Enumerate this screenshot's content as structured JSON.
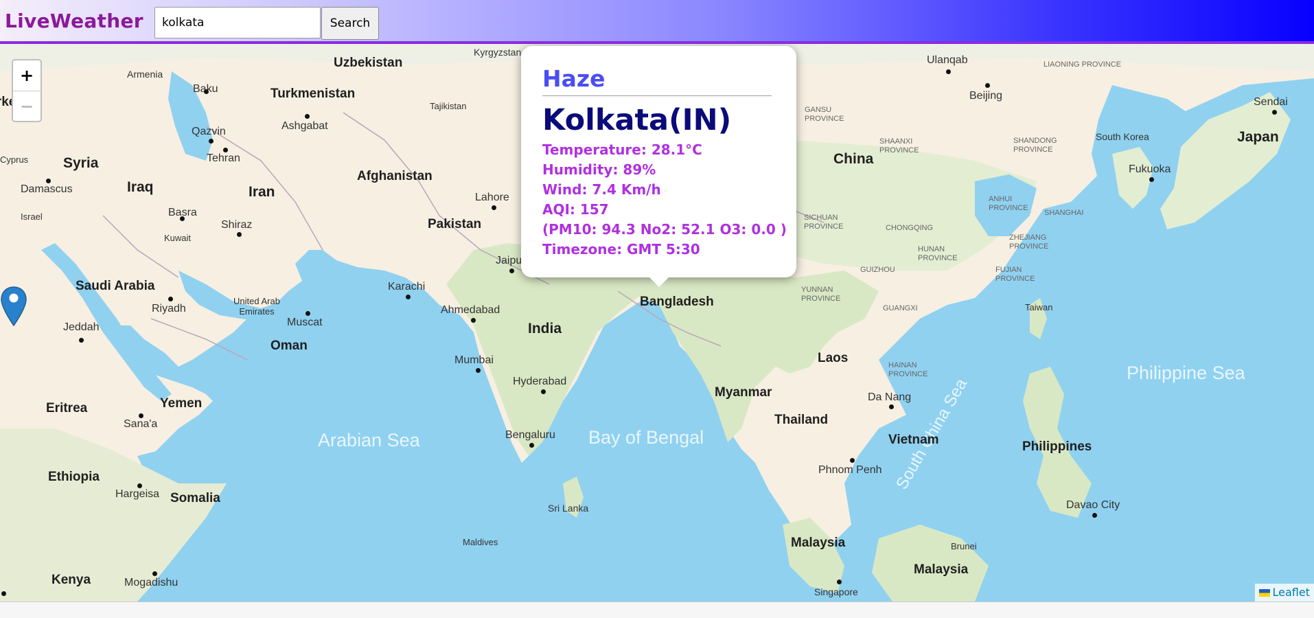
{
  "header": {
    "brand": "LiveWeather",
    "search_value": "kolkata",
    "search_button": "Search"
  },
  "map": {
    "zoom_in": "+",
    "zoom_out": "−",
    "attribution": "Leaflet",
    "countries": [
      "Uzbekistan",
      "Kyrgyzstan",
      "Turkmenistan",
      "Tajikistan",
      "Afghanistan",
      "Pakistan",
      "India",
      "Bangladesh",
      "China",
      "Iran",
      "Iraq",
      "Syria",
      "Saudi Arabia",
      "Oman",
      "Yemen",
      "Eritrea",
      "Ethiopia",
      "Somalia",
      "Kenya",
      "United Arab Emirates",
      "Kuwait",
      "Israel",
      "Cyprus",
      "Myanmar",
      "Thailand",
      "Laos",
      "Vietnam",
      "Malaysia",
      "Philippines",
      "Japan",
      "South Korea",
      "Sri Lanka",
      "Maldives",
      "Taiwan",
      "Brunei",
      "Singapore",
      "Turkey"
    ],
    "seas": [
      "Arabian Sea",
      "Bay of Bengal",
      "Philippine Sea",
      "South China Sea"
    ],
    "cities": [
      "Armenia",
      "Baku",
      "Qazvin",
      "Tehran",
      "Ashgabat",
      "Damascus",
      "Basra",
      "Shiraz",
      "Riyadh",
      "Jeddah",
      "Muscat",
      "Sana'a",
      "Hargeisa",
      "Mogadishu",
      "Karachi",
      "Lahore",
      "Jaipur",
      "Ahmedabad",
      "Mumbai",
      "Hyderabad",
      "Bengaluru",
      "Beijing",
      "Ulanqab",
      "Sendai",
      "Fukuoka",
      "Da Nang",
      "Phnom Penh",
      "Davao City",
      "Kolkata"
    ],
    "provinces": [
      "Liaoning Province",
      "Gansu Province",
      "Shaanxi Province",
      "Shandong Province",
      "Anhui Province",
      "Shanghai",
      "Sichuan Province",
      "Chongqing",
      "Hunan Province",
      "Zhejiang Province",
      "Fujian Province",
      "Guizhou",
      "Yunnan Province",
      "Guangxi",
      "Hainan Province"
    ]
  },
  "popup": {
    "condition": "Haze",
    "city": "Kolkata(IN)",
    "temperature": "Temperature: 28.1°C",
    "humidity": "Humidity: 89%",
    "wind": "Wind: 7.4 Km/h",
    "aqi": "AQI: 157",
    "pollutants": "(PM10: 94.3 No2: 52.1 O3: 0.0 )",
    "timezone": "Timezone: GMT 5:30"
  },
  "colors": {
    "brand": "#8b1a9a",
    "popup_condition": "#4a4ef0",
    "popup_city": "#0a0a7a",
    "popup_details": "#b030e0",
    "water": "#90d1f0",
    "marker": "#2a81cb"
  }
}
